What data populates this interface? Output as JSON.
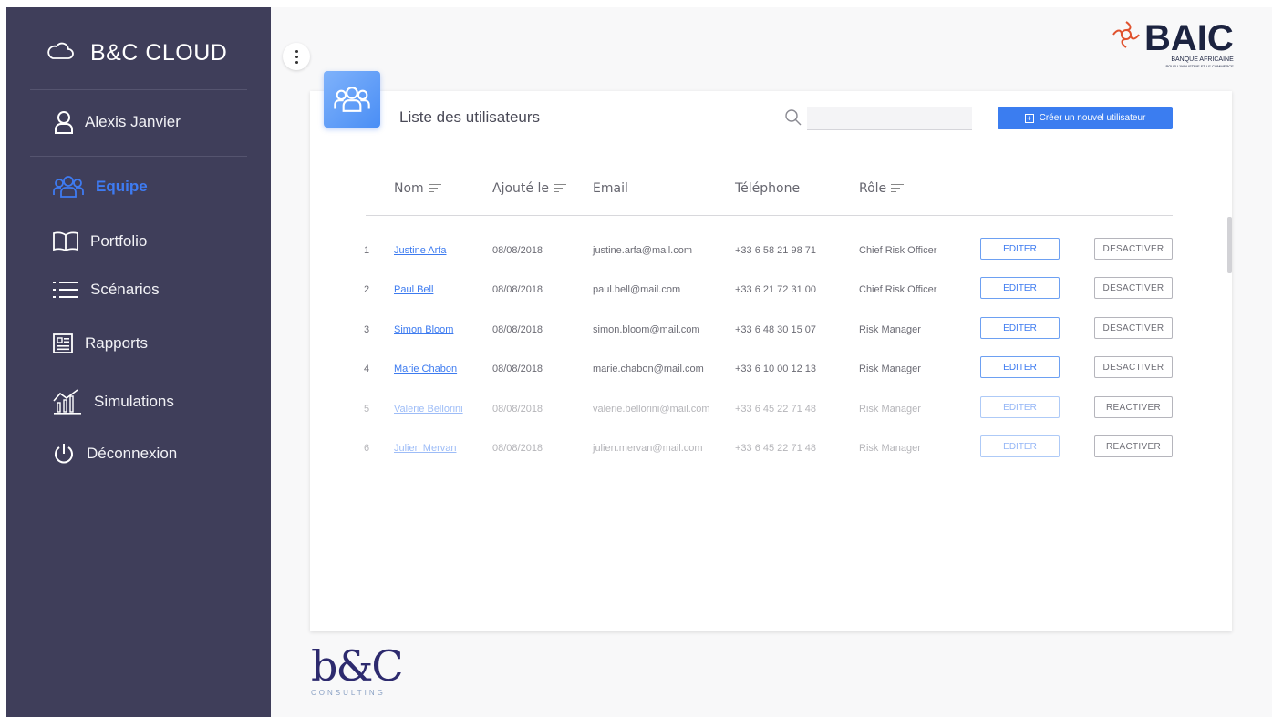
{
  "app": {
    "brand": "B&C CLOUD",
    "user_name": "Alexis Janvier"
  },
  "sidebar": {
    "items": [
      {
        "label": "Equipe",
        "icon": "team-icon",
        "active": true
      },
      {
        "label": "Portfolio",
        "icon": "book-icon",
        "active": false
      },
      {
        "label": "Scénarios",
        "icon": "list-icon",
        "active": false
      },
      {
        "label": "Rapports",
        "icon": "report-icon",
        "active": false
      },
      {
        "label": "Simulations",
        "icon": "simulation-chart-icon",
        "active": false
      },
      {
        "label": "Déconnexion",
        "icon": "power-icon",
        "active": false
      }
    ]
  },
  "header_logo": {
    "name": "BAIC",
    "subtitle_line1": "BANQUE AFRICAINE",
    "subtitle_line2": "POUR L'INDUSTRIE ET LE COMMERCE"
  },
  "users_panel": {
    "title": "Liste des utilisateurs",
    "search_placeholder": "",
    "create_button": "Créer un nouvel utilisateur",
    "columns": {
      "name": "Nom",
      "added": "Ajouté le",
      "email": "Email",
      "phone": "Téléphone",
      "role": "Rôle"
    },
    "rows": [
      {
        "num": "1",
        "name": "Justine Arfa",
        "date": "08/08/2018",
        "email": "justine.arfa@mail.com",
        "phone": "+33 6 58 21 98 71",
        "role": "Chief Risk Officer",
        "edit": "EDITER",
        "toggle": "DESACTIVER",
        "active": true
      },
      {
        "num": "2",
        "name": "Paul Bell",
        "date": "08/08/2018",
        "email": "paul.bell@mail.com",
        "phone": "+33 6 21 72 31 00",
        "role": "Chief Risk Officer",
        "edit": "EDITER",
        "toggle": "DESACTIVER",
        "active": true
      },
      {
        "num": "3",
        "name": "Simon Bloom",
        "date": "08/08/2018",
        "email": "simon.bloom@mail.com",
        "phone": "+33 6 48 30 15 07",
        "role": "Risk Manager",
        "edit": "EDITER",
        "toggle": "DESACTIVER",
        "active": true
      },
      {
        "num": "4",
        "name": "Marie Chabon",
        "date": "08/08/2018",
        "email": "marie.chabon@mail.com",
        "phone": "+33 6 10 00 12 13",
        "role": "Risk Manager",
        "edit": "EDITER",
        "toggle": "DESACTIVER",
        "active": true
      },
      {
        "num": "5",
        "name": "Valerie Bellorini",
        "date": "08/08/2018",
        "email": "valerie.bellorini@mail.com",
        "phone": "+33 6 45 22 71 48",
        "role": "Risk Manager",
        "edit": "EDITER",
        "toggle": "REACTIVER",
        "active": false
      },
      {
        "num": "6",
        "name": "Julien Mervan",
        "date": "08/08/2018",
        "email": "julien.mervan@mail.com",
        "phone": "+33 6 45 22 71 48",
        "role": "Risk Manager",
        "edit": "EDITER",
        "toggle": "REACTIVER",
        "active": false
      }
    ]
  },
  "footer_logo": {
    "name": "b&C",
    "subtitle": "CONSULTING"
  },
  "colors": {
    "sidebar_bg": "#3f3e5a",
    "accent": "#3b7df0",
    "background": "#f8f8f9"
  }
}
